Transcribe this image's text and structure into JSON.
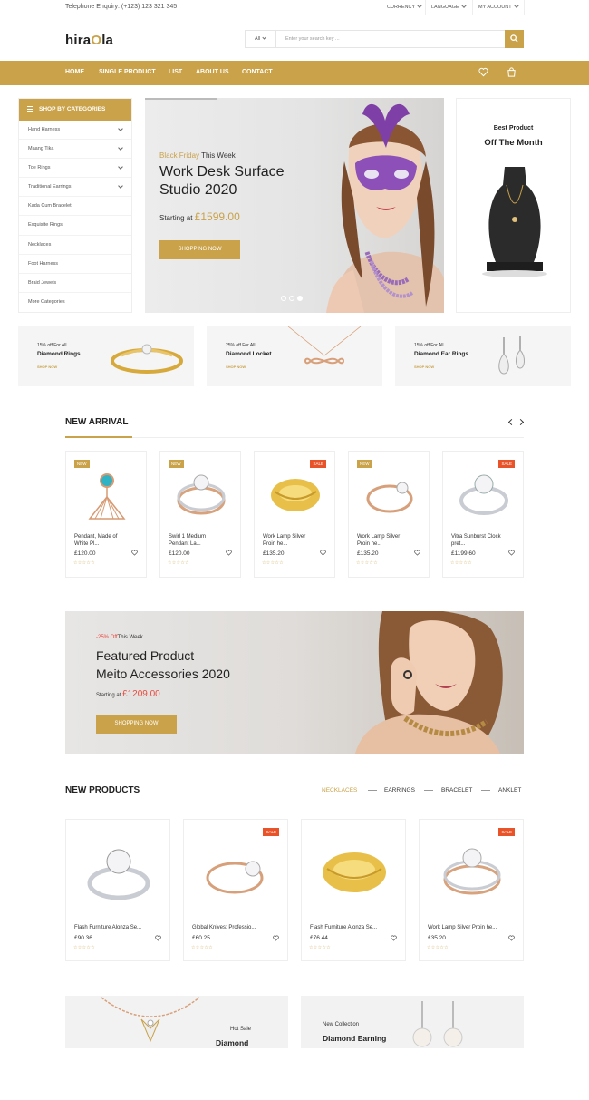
{
  "topbar": {
    "phone": "Telephone Enquiry: (+123) 123 321 345",
    "currency": "Currency",
    "language": "Language",
    "account": "My Account"
  },
  "header": {
    "logo_pre": "hira",
    "logo_o": "O",
    "logo_post": "la",
    "search_category": "All",
    "search_placeholder": "Enter your search key ..."
  },
  "nav": {
    "items": [
      "Home",
      "Single Product",
      "List",
      "About Us",
      "Contact"
    ]
  },
  "categories": {
    "title": "Shop By Categories",
    "items": [
      {
        "label": "Hand Harness"
      },
      {
        "label": "Maang Tika"
      },
      {
        "label": "Toe Rings"
      },
      {
        "label": "Traditional Earrings"
      },
      {
        "label": "Kada Cum Bracelet"
      },
      {
        "label": "Exquisite Rings"
      },
      {
        "label": "Necklaces"
      },
      {
        "label": "Foot Harness"
      },
      {
        "label": "Braid Jewels"
      },
      {
        "label": "More Categories"
      }
    ]
  },
  "hero": {
    "tag_gold": "Black Friday",
    "tag_rest": " This Week",
    "title": "Work Desk Surface Studio 2020",
    "price_prefix": "Starting at ",
    "price": "£1599.00",
    "cta": "Shopping Now"
  },
  "best": {
    "line1": "Best Product",
    "line2": "Off The Month"
  },
  "promos": [
    {
      "discount": "15% off For All",
      "title": "Diamond Rings",
      "link": "Shop Now"
    },
    {
      "discount": "25% off For All",
      "title": "Diamond Locket",
      "link": "Shop Now"
    },
    {
      "discount": "15% off For All",
      "title": "Diamond Ear Rings",
      "link": "Shop Now"
    }
  ],
  "new_arrival": {
    "title": "New Arrival",
    "products": [
      {
        "badge": "New",
        "name1": "Pendant, Made of",
        "name2": "White Pl...",
        "price": "£120.00",
        "stars": "☆☆☆☆☆"
      },
      {
        "badge": "New",
        "name1": "Swirl 1 Medium",
        "name2": "Pendant La...",
        "price": "£120.00",
        "stars": "☆☆☆☆☆"
      },
      {
        "badge": "Sale",
        "name1": "Work Lamp Silver",
        "name2": "Proin he...",
        "price": "£135.20",
        "stars": "☆☆☆☆☆"
      },
      {
        "badge": "New",
        "name1": "Work Lamp Silver",
        "name2": "Proin he...",
        "price": "£135.20",
        "stars": "☆☆☆☆☆"
      },
      {
        "badge": "Sale",
        "name1": "Vitra Sunburst Clock",
        "name2": "pret...",
        "price": "£1199.60",
        "stars": "☆☆☆☆☆"
      }
    ]
  },
  "featured": {
    "tag_red": "-25% Off",
    "tag_rest": "This Week",
    "title1": "Featured Product",
    "title2": "Meito Accessories 2020",
    "price_prefix": "Starting at ",
    "price": "£1209.00",
    "cta": "Shopping Now"
  },
  "new_products": {
    "title": "New Products",
    "tabs": [
      "Necklaces",
      "Earrings",
      "Bracelet",
      "Anklet"
    ],
    "products": [
      {
        "badge": "",
        "name": "Flash Furniture Alonza Se...",
        "price": "£90.36",
        "stars": "☆☆☆☆☆"
      },
      {
        "badge": "Sale",
        "name": "Global Knives: Professio...",
        "price": "£60.25",
        "stars": "☆☆☆☆☆"
      },
      {
        "badge": "",
        "name": "Flash Furniture Alonza Se...",
        "price": "£76.44",
        "stars": "☆☆☆☆☆"
      },
      {
        "badge": "Sale",
        "name": "Work Lamp Silver Proin he...",
        "price": "£35.20",
        "stars": "☆☆☆☆☆"
      }
    ]
  },
  "bottom_banners": [
    {
      "line1": "Hot Sale",
      "line2": "Diamond"
    },
    {
      "line1": "New Collection",
      "line2": "Diamond Earning"
    }
  ],
  "colors": {
    "accent": "#c9a24a",
    "sale": "#e8532a",
    "price_red": "#e84a3c"
  }
}
